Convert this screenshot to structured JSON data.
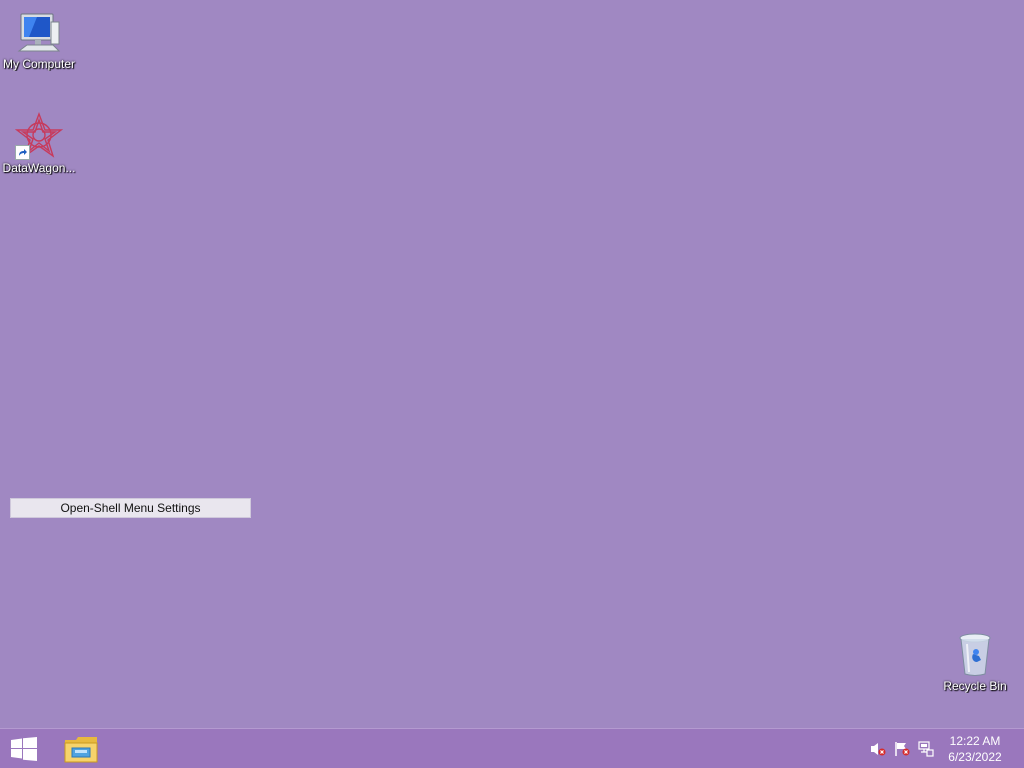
{
  "desktop": {
    "icons": [
      {
        "label": "My Computer",
        "icon": "computer-icon"
      },
      {
        "label": "DataWagon...",
        "icon": "datawagon-icon"
      },
      {
        "label": "Recycle Bin",
        "icon": "recycle-bin-icon"
      }
    ],
    "menu_label": "Open-Shell Menu Settings"
  },
  "taskbar": {
    "start_icon": "windows-logo-icon",
    "pinned_app_icon": "file-explorer-icon",
    "tray": {
      "icons": [
        "volume-muted-icon",
        "action-center-flag-icon",
        "network-icon"
      ],
      "time": "12:22 AM",
      "date": "6/23/2022"
    }
  },
  "colors": {
    "desktop_background": "#a088c2",
    "taskbar_background": "#9a77bd"
  }
}
